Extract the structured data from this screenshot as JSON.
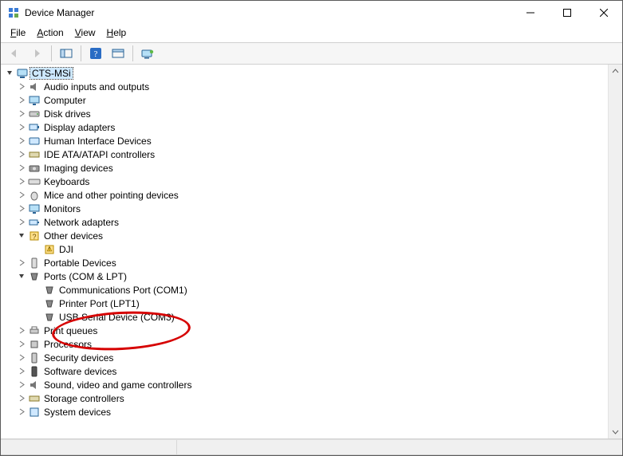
{
  "window": {
    "title": "Device Manager"
  },
  "menu": {
    "file": "File",
    "action": "Action",
    "view": "View",
    "help": "Help"
  },
  "toolbar": {
    "back": "Back",
    "forward": "Forward",
    "show_hide": "Show/Hide Console Tree",
    "help": "Help",
    "props": "Properties",
    "monitor": "Show hidden devices"
  },
  "tree": {
    "root": "CTS-MSi",
    "audio": "Audio inputs and outputs",
    "computer": "Computer",
    "disk": "Disk drives",
    "display": "Display adapters",
    "hid": "Human Interface Devices",
    "ide": "IDE ATA/ATAPI controllers",
    "imaging": "Imaging devices",
    "keyboards": "Keyboards",
    "mice": "Mice and other pointing devices",
    "monitors": "Monitors",
    "network": "Network adapters",
    "other": "Other devices",
    "other_dji": "DJI",
    "portable": "Portable Devices",
    "ports": "Ports (COM & LPT)",
    "ports_com1": "Communications Port (COM1)",
    "ports_lpt1": "Printer Port (LPT1)",
    "ports_usb3": "USB Serial Device (COM3)",
    "printq": "Print queues",
    "processors": "Processors",
    "security": "Security devices",
    "software": "Software devices",
    "sound": "Sound, video and game controllers",
    "storage": "Storage controllers",
    "system": "System devices"
  },
  "annotation": {
    "circled_item": "USB Serial Device (COM3)"
  }
}
